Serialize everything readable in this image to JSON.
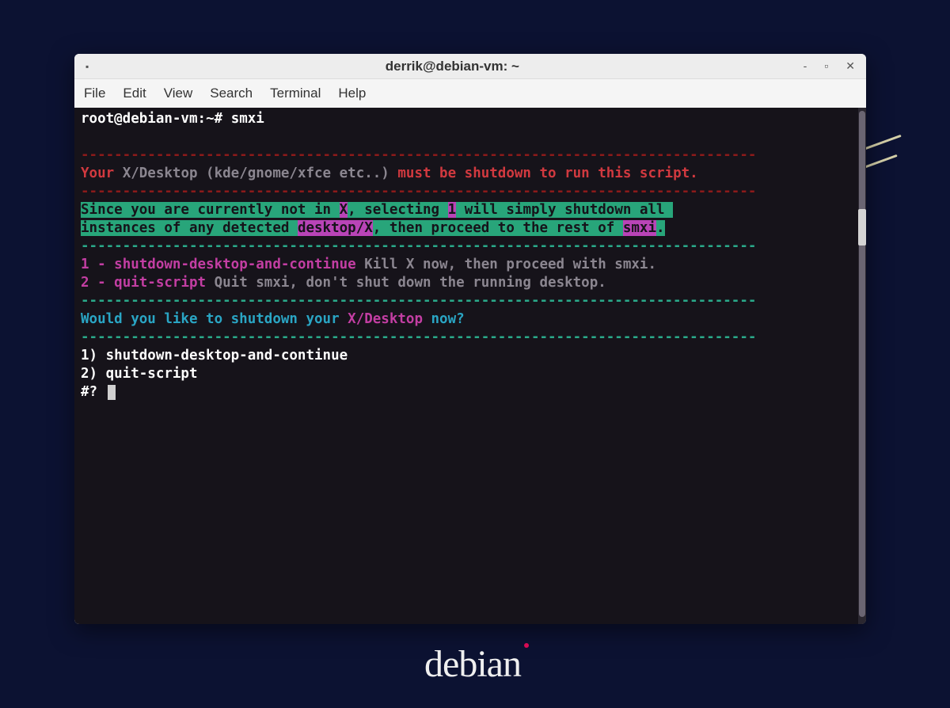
{
  "desktop": {
    "brand": "debian"
  },
  "window": {
    "title": "derrik@debian-vm: ~",
    "controls": {
      "minimize": "‐",
      "maximize": "▫",
      "close": "✕"
    },
    "menu": {
      "file": "File",
      "edit": "Edit",
      "view": "View",
      "search": "Search",
      "terminal": "Terminal",
      "help": "Help"
    }
  },
  "term": {
    "prompt_user": "root@debian-vm",
    "prompt_sep": ":",
    "prompt_path": "~#",
    "cmd": "smxi",
    "dash_row": "---------------------------------------------------------------------------------",
    "warn_prefix": "Your ",
    "warn_de": "X/Desktop (kde/gnome/xfce etc..)",
    "warn_suffix": " must be shutdown to run this script.",
    "info_a": "Since you are currently not in ",
    "info_x": "X",
    "info_b": ", selecting ",
    "info_1": "1",
    "info_c": " will simply shutdown all ",
    "info_d": "instances of any detected ",
    "info_dx": "desktop/X",
    "info_e": ", then proceed to the rest of ",
    "info_sm": "smxi",
    "info_period": ".",
    "opt1_num": "1 - ",
    "opt1_name": "shutdown-desktop-and-continue ",
    "opt1_desc": "Kill X now, then proceed with smxi.",
    "opt2_num": "2 - ",
    "opt2_name": "quit-script ",
    "opt2_desc": "Quit smxi, don't shut down the running desktop.",
    "question_a": "Would you like to shutdown your ",
    "question_b": "X/Desktop",
    "question_c": " now?",
    "menu1": "1) shutdown-desktop-and-continue",
    "menu2": "2) quit-script",
    "prompt_q": "#? "
  }
}
